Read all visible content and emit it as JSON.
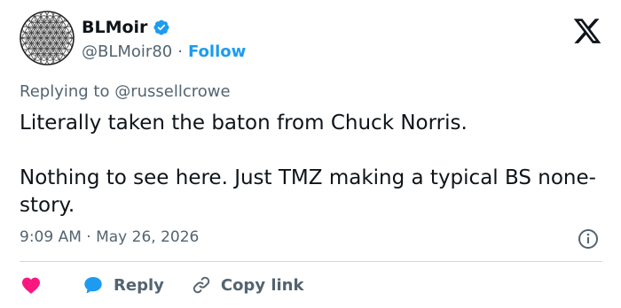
{
  "tweet": {
    "author": {
      "display_name": "BLMoir",
      "handle": "@BLMoir80",
      "separator": "·",
      "follow_label": "Follow"
    },
    "replying_prefix": "Replying to",
    "replying_to": "@russellcrowe",
    "body": "Literally taken the baton from Chuck Norris.\n\nNothing to see here. Just TMZ making a typical BS none-story.",
    "timestamp": "9:09 AM · May 26, 2026"
  },
  "actions": {
    "reply_label": "Reply",
    "copy_link_label": "Copy link"
  },
  "icons": {
    "verified": "verified-badge-icon",
    "logo": "x-logo-icon",
    "info": "info-icon",
    "like": "heart-icon",
    "reply": "speech-bubble-icon",
    "copy": "link-icon"
  },
  "colors": {
    "accent": "#1d9bf0",
    "like": "#f91880",
    "text": "#0f1419",
    "muted": "#536471",
    "divider": "#cfd9de"
  }
}
